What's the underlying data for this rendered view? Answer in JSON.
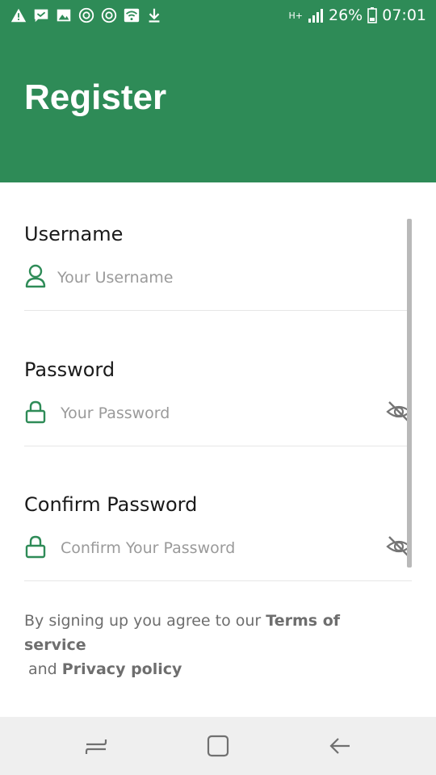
{
  "status_bar": {
    "left_icons": [
      "warning-icon",
      "message-icon",
      "image-icon",
      "sync-icon",
      "sync-icon",
      "wifi-icon",
      "download-icon"
    ],
    "network": "H+",
    "battery": "26%",
    "time": "07:01"
  },
  "header": {
    "title": "Register"
  },
  "form": {
    "username": {
      "label": "Username",
      "placeholder": "Your Username",
      "icon": "user-icon"
    },
    "password": {
      "label": "Password",
      "placeholder": "Your Password",
      "icon": "lock-icon",
      "toggle_icon": "eye-off-icon"
    },
    "confirm_password": {
      "label": "Confirm Password",
      "placeholder": "Confirm Your Password",
      "icon": "lock-icon",
      "toggle_icon": "eye-off-icon"
    }
  },
  "terms": {
    "prefix": "By signing up you agree to our",
    "terms_link": "Terms of service",
    "connector": "and",
    "privacy_link": "Privacy policy"
  },
  "nav_bar": {
    "buttons": [
      "recents-icon",
      "home-icon",
      "back-icon"
    ]
  },
  "colors": {
    "accent": "#2e8b57",
    "placeholder": "#9a9a9a",
    "divider": "#e6e6e6"
  }
}
